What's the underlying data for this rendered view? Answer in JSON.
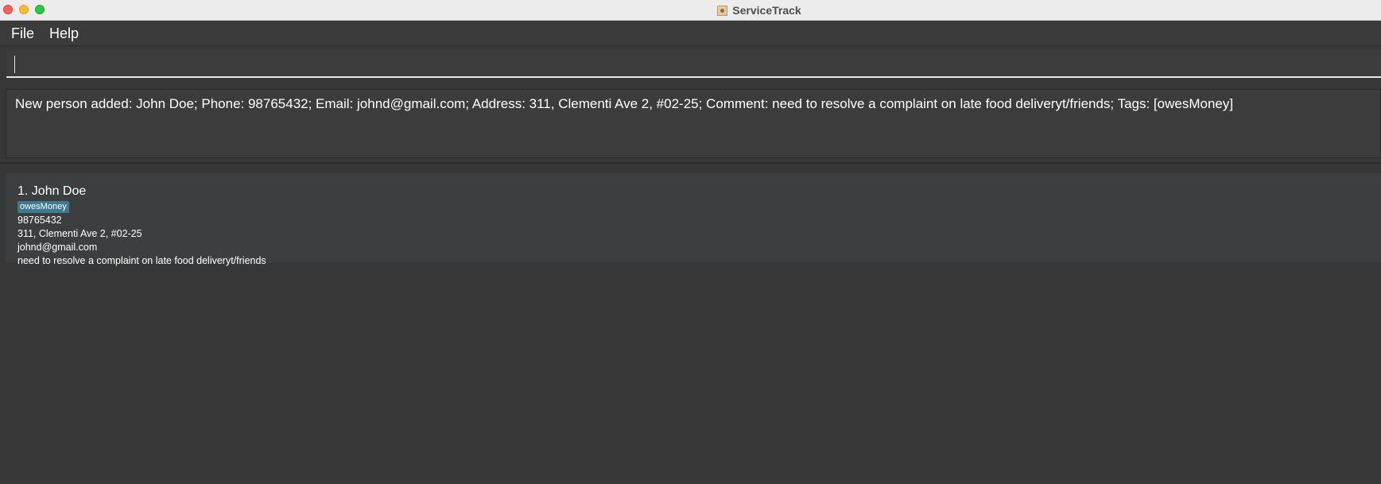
{
  "window": {
    "title": "ServiceTrack",
    "app_icon": "address-book-icon"
  },
  "menu": {
    "file_label": "File",
    "help_label": "Help"
  },
  "command": {
    "value": "",
    "placeholder": ""
  },
  "result": {
    "message": "New person added: John Doe; Phone: 98765432; Email: johnd@gmail.com; Address: 311, Clementi Ave 2, #02-25; Comment: need to resolve a complaint on late food deliveryt/friends; Tags: [owesMoney]"
  },
  "persons": [
    {
      "index_name": "1. John Doe",
      "tags": [
        "owesMoney"
      ],
      "phone": "98765432",
      "address": "311, Clementi Ave 2, #02-25",
      "email": "johnd@gmail.com",
      "comment": "need to resolve a complaint on late food deliveryt/friends"
    }
  ],
  "colors": {
    "background": "#373737",
    "tag": "#3e7b91",
    "card": "#3d3e40"
  }
}
